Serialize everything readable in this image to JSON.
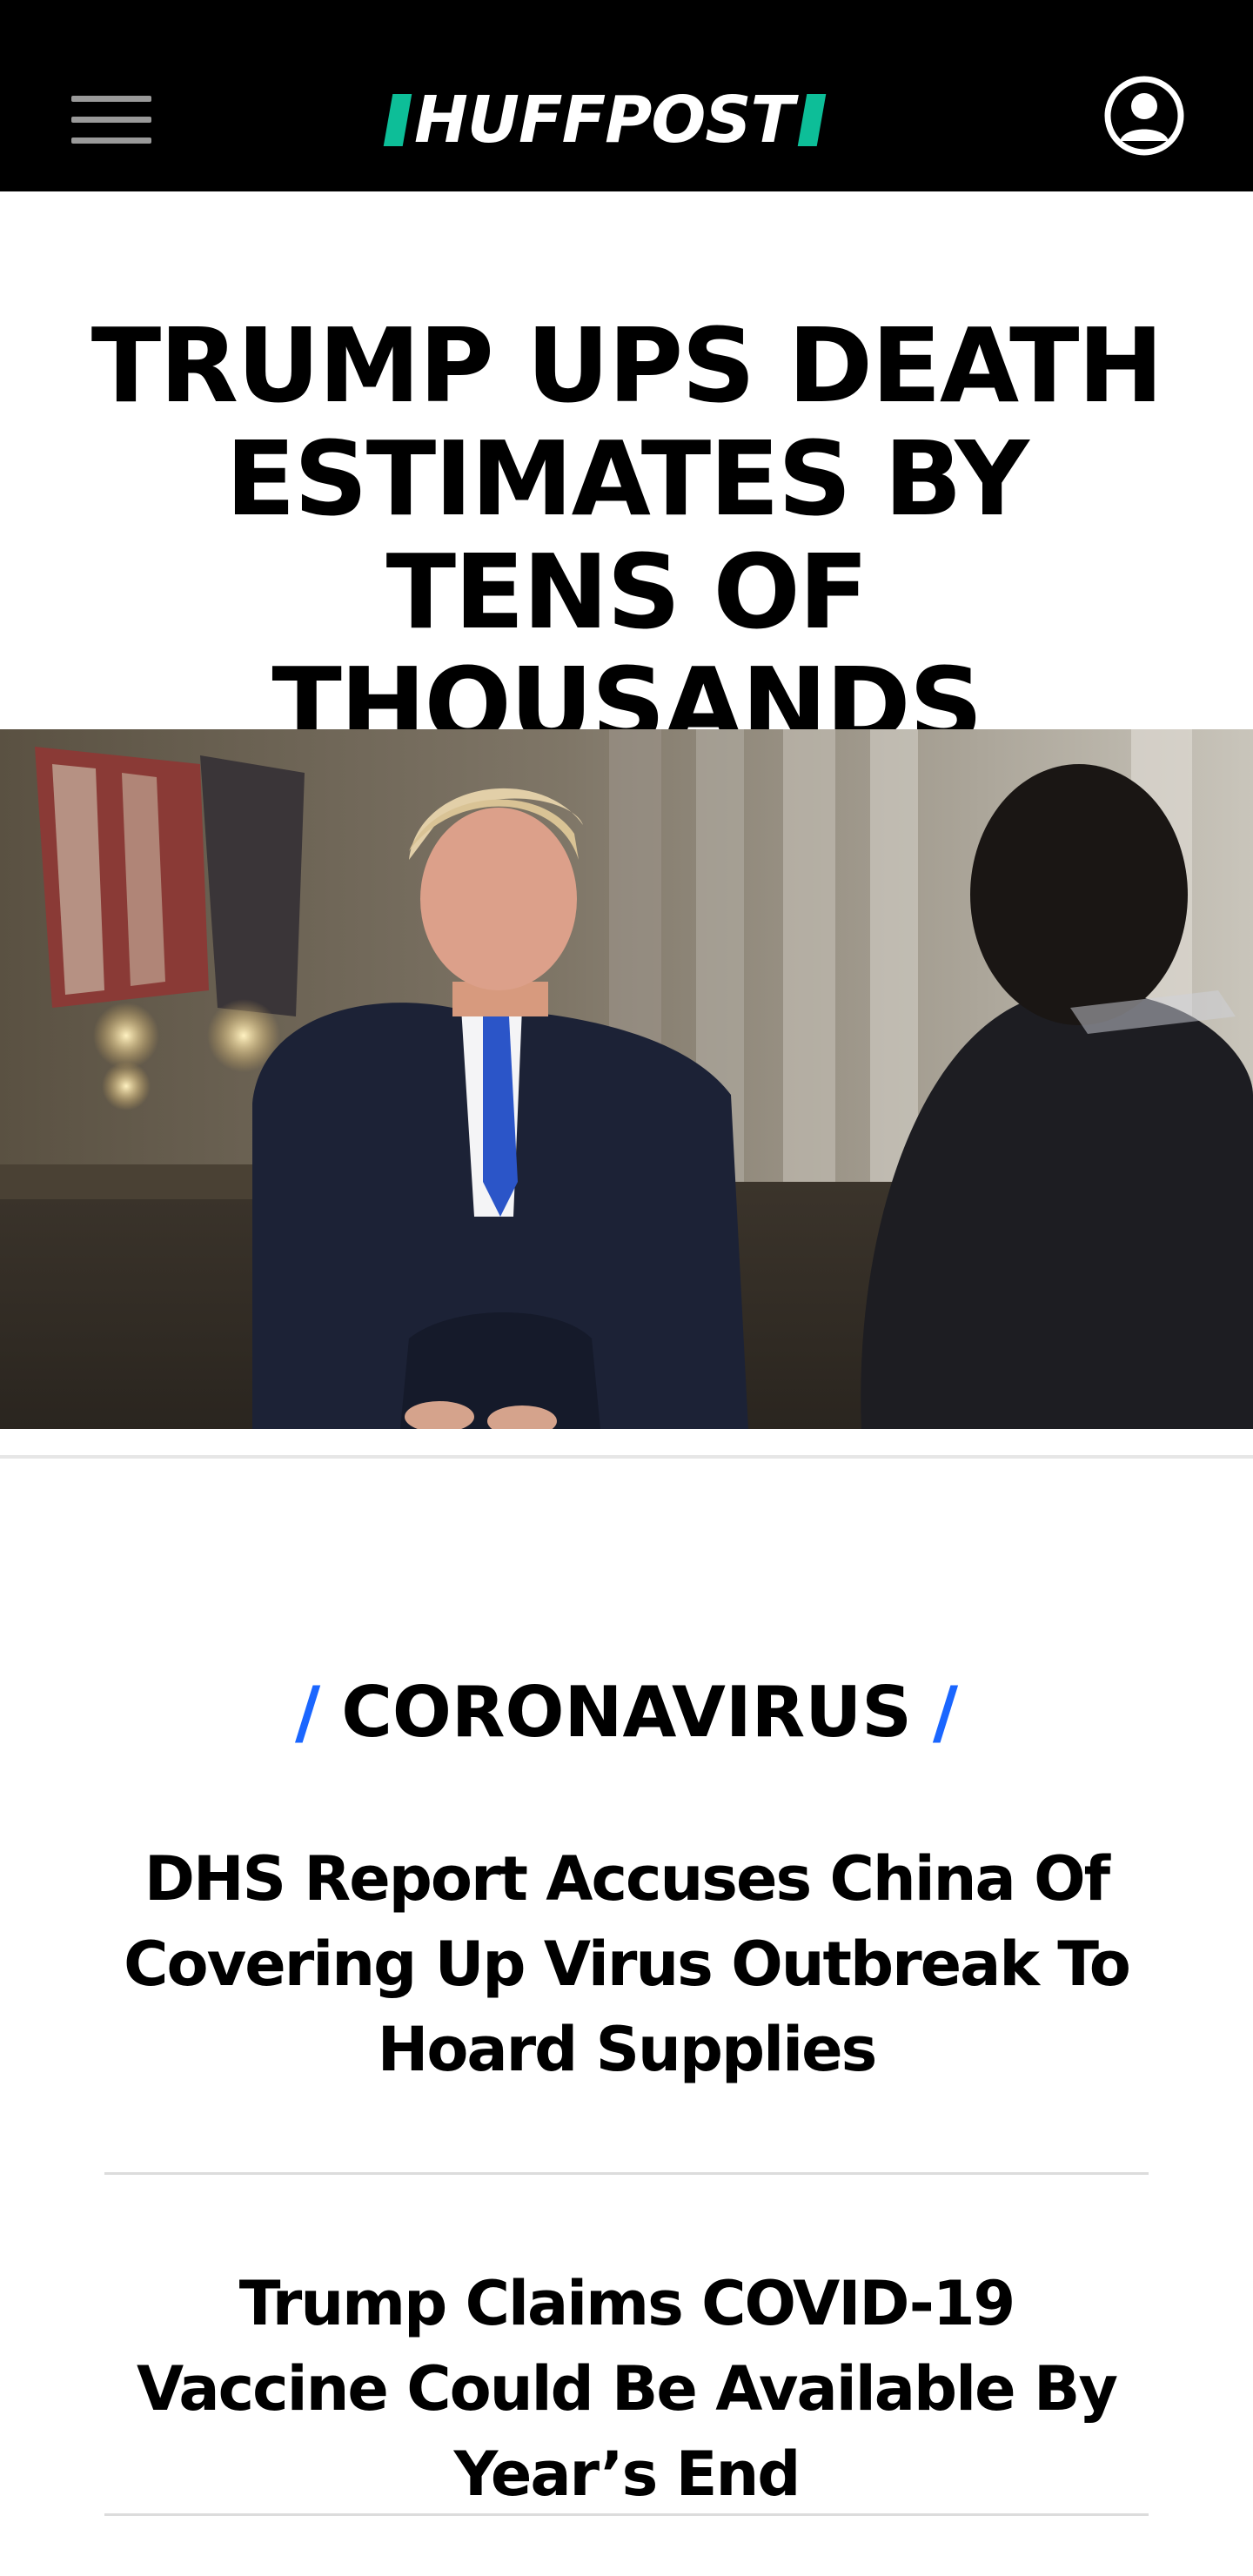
{
  "header": {
    "logo_text": "HUFFPOST",
    "menu_icon": "hamburger-menu-icon",
    "account_icon": "user-account-icon",
    "colors": {
      "background": "#000000",
      "logo_accent": "#0dbe98",
      "menu_icon": "#9a9a9a"
    }
  },
  "top_story": {
    "headline": "TRUMP UPS DEATH ESTIMATES BY TENS OF THOUSANDS"
  },
  "section": {
    "name": "CORONAVIRUS",
    "slash": "/",
    "accent_color": "#1a66ff"
  },
  "stories": [
    {
      "headline": "DHS Report Accuses China Of Covering Up Virus Outbreak To Hoard Supplies"
    },
    {
      "headline": "Trump Claims COVID-19 Vaccine Could Be Available By Year’s End"
    }
  ]
}
